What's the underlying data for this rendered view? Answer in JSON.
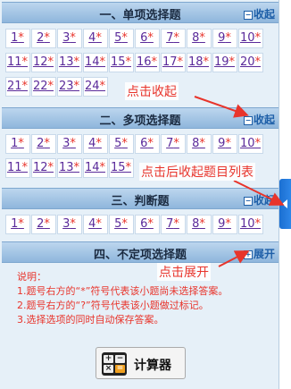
{
  "sections": [
    {
      "title": "一、单项选择题",
      "toggle": "收起",
      "toggle_sign": "−",
      "questions": [
        "1",
        "2",
        "3",
        "4",
        "5",
        "6",
        "7",
        "8",
        "9",
        "10",
        "11",
        "12",
        "13",
        "14",
        "15",
        "16",
        "17",
        "18",
        "19",
        "20",
        "21",
        "22",
        "23",
        "24"
      ]
    },
    {
      "title": "二、多项选择题",
      "toggle": "收起",
      "toggle_sign": "−",
      "questions": [
        "1",
        "2",
        "3",
        "4",
        "5",
        "6",
        "7",
        "8",
        "9",
        "10",
        "11",
        "12",
        "13",
        "14",
        "15"
      ]
    },
    {
      "title": "三、判断题",
      "toggle": "收起",
      "toggle_sign": "−",
      "questions": [
        "1",
        "2",
        "3",
        "4",
        "5",
        "6",
        "7",
        "8",
        "9",
        "10"
      ]
    },
    {
      "title": "四、不定项选择题",
      "toggle": "展开",
      "toggle_sign": "+"
    }
  ],
  "unanswered_mark": "*",
  "annotations": {
    "collapse": "点击收起",
    "list_after_collapse": "点击后收起题目列表",
    "expand": "点击展开"
  },
  "description": {
    "heading": "说明：",
    "lines": [
      "1.题号右方的“*”符号代表该小题尚未选择答案。",
      "2.题号右方的“?”符号代表该小题做过标记。",
      "3.选择选项的同时自动保存答案。"
    ]
  },
  "calculator": {
    "label": "计算器"
  },
  "colors": {
    "accent_red": "#e8342b",
    "link_purple": "#5a2a9a",
    "header_blue": "#8fb6dc",
    "tab_blue": "#1b6fd1"
  }
}
